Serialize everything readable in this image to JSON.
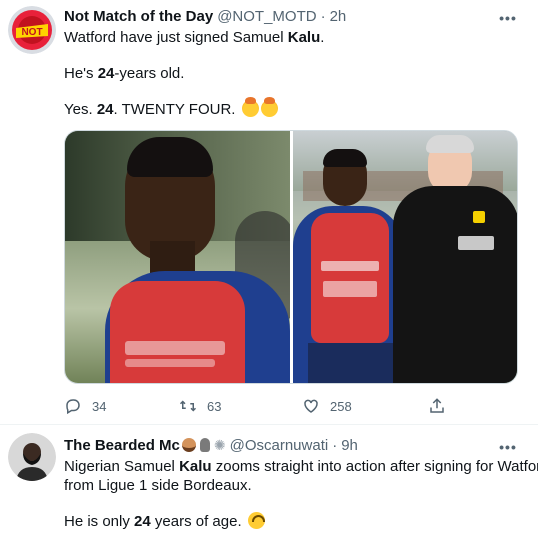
{
  "tweet1": {
    "display_name": "Not Match of the Day",
    "handle": "@NOT_MOTD",
    "separator": "·",
    "time": "2h",
    "more_label": "•••",
    "line1": {
      "a": "Watford have just signed Samuel ",
      "b": "Kalu",
      "c": "."
    },
    "line2": {
      "a": "He's ",
      "b": "24",
      "c": "-years old."
    },
    "line3": {
      "a": "Yes. ",
      "b": "24",
      "c": ". TWENTY FOUR. "
    },
    "emojis": [
      "exploding-head-emoji",
      "exploding-head-emoji"
    ],
    "images": [
      "player-portrait-photo",
      "player-with-manager-photo"
    ],
    "actions": {
      "replies": "34",
      "retweets": "63",
      "likes": "258"
    }
  },
  "tweet2": {
    "display_name": "The Bearded Mc",
    "handle": "@Oscarnuwati",
    "separator": "·",
    "time": "9h",
    "more_label": "•••",
    "name_emojis": [
      "bearded-face-emoji",
      "microphone-emoji",
      "sparkle-emoji"
    ],
    "line1": {
      "a": "Nigerian Samuel ",
      "b": "Kalu",
      "c": " zooms straight into action after signing for Watford"
    },
    "line2": "from Ligue 1 side Bordeaux.",
    "line3": {
      "a": "He is only ",
      "b": "24",
      "c": " years of age. "
    },
    "emoji": "upside-down-face-emoji"
  },
  "colors": {
    "text": "#0f1419",
    "secondary": "#536471",
    "divider": "#eff3f4"
  }
}
